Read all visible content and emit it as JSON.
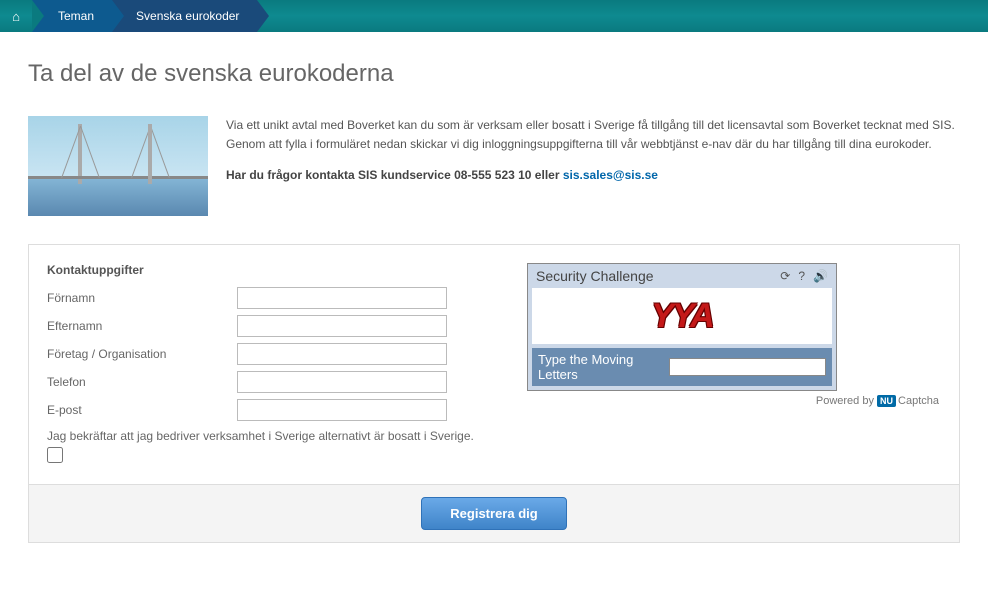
{
  "nav": {
    "home_label": "⌂",
    "crumbs": [
      "Teman",
      "Svenska eurokoder"
    ]
  },
  "page_title": "Ta del av de svenska eurokoderna",
  "intro": {
    "paragraph": "Via ett unikt avtal med Boverket kan du som är verksam eller bosatt i Sverige få tillgång till det licensavtal som Boverket tecknat med SIS. Genom att fylla i formuläret nedan skickar vi dig inloggningsuppgifterna till vår webbtjänst e-nav där du har tillgång till dina eurokoder.",
    "contact_prefix": "Har du frågor kontakta SIS kundservice 08-555 523 10 eller ",
    "contact_email": "sis.sales@sis.se"
  },
  "form": {
    "section_title": "Kontaktuppgifter",
    "fields": {
      "fornamn": {
        "label": "Förnamn",
        "value": ""
      },
      "efternamn": {
        "label": "Efternamn",
        "value": ""
      },
      "foretag": {
        "label": "Företag / Organisation",
        "value": ""
      },
      "telefon": {
        "label": "Telefon",
        "value": ""
      },
      "epost": {
        "label": "E-post",
        "value": ""
      }
    },
    "confirm_text": "Jag bekräftar att jag bedriver verksamhet i Sverige alternativt är bosatt i Sverige.",
    "submit_label": "Registrera dig"
  },
  "captcha": {
    "title": "Security Challenge",
    "letters": "YYA",
    "prompt": "Type the Moving Letters",
    "credit_prefix": "Powered by ",
    "credit_brand_prefix": "NU",
    "credit_brand": "Captcha",
    "icons": {
      "refresh": "⟳",
      "help": "?",
      "audio": "🔊"
    }
  }
}
